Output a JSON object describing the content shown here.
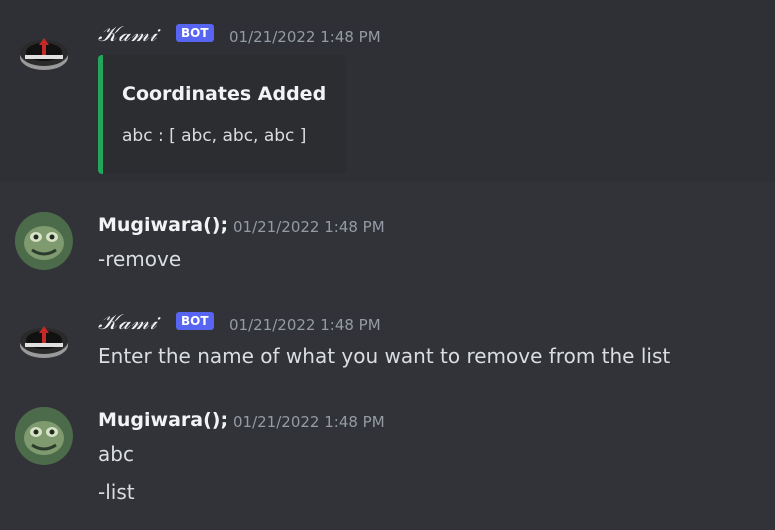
{
  "messages": [
    {
      "author": "𝒦𝒶𝓂𝒾",
      "badge": "BOT",
      "timestamp": "01/21/2022 1:48 PM",
      "embed": {
        "title": "Coordinates Added",
        "description": "abc : [ abc, abc, abc ]",
        "accent": "#23a55a"
      }
    },
    {
      "author": "Mugiwara();",
      "timestamp": "01/21/2022 1:48 PM",
      "lines": [
        "-remove"
      ]
    },
    {
      "author": "𝒦𝒶𝓂𝒾",
      "badge": "BOT",
      "timestamp": "01/21/2022 1:48 PM",
      "lines": [
        "Enter the name of what you want to remove from the list"
      ]
    },
    {
      "author": "Mugiwara();",
      "timestamp": "01/21/2022 1:48 PM",
      "lines": [
        "abc",
        "-list"
      ]
    }
  ],
  "colors": {
    "background": "#313338",
    "badge": "#5865f2",
    "timestamp": "#949ba4"
  },
  "icons": {
    "bot_avatar": "compass-icon",
    "user_avatar": "frog-avatar-icon"
  }
}
